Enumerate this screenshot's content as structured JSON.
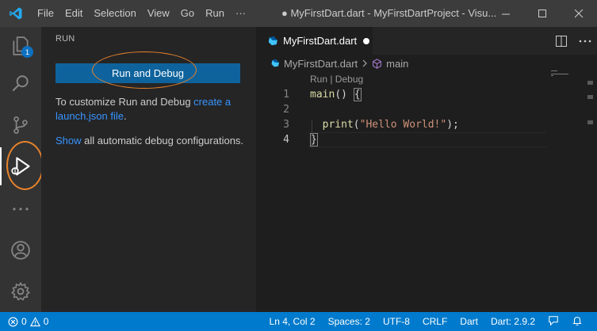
{
  "menu": [
    "File",
    "Edit",
    "Selection",
    "View",
    "Go",
    "Run",
    "···"
  ],
  "window_title": "● MyFirstDart.dart - MyFirstDartProject - Visu...",
  "activity_badge": "1",
  "sidebar": {
    "title": "RUN",
    "run_button": "Run and Debug",
    "customize_text": "To customize Run and Debug ",
    "customize_link": "create a launch.json file",
    "customize_end": ".",
    "show_link": "Show",
    "show_text": " all automatic debug configurations."
  },
  "editor": {
    "tab_label": "MyFirstDart.dart",
    "breadcrumb_file": "MyFirstDart.dart",
    "breadcrumb_symbol": "main",
    "codelens": "Run | Debug",
    "lines": [
      {
        "num": "1",
        "fn": "main",
        "rest": "() "
      },
      {
        "num": "2"
      },
      {
        "num": "3",
        "fn": "print",
        "str": "\"Hello World!\"",
        "end": ");"
      },
      {
        "num": "4"
      }
    ],
    "line1_brace": "{",
    "line3_indent": "  ",
    "line3_open": "(",
    "line4_brace": "}"
  },
  "status": {
    "errors": "0",
    "warnings": "0",
    "position": "Ln 4, Col 2",
    "spaces": "Spaces: 2",
    "encoding": "UTF-8",
    "eol": "CRLF",
    "language": "Dart",
    "sdk": "Dart: 2.9.2"
  },
  "colors": {
    "accent": "#007acc",
    "button": "#0e639c",
    "annotation": "#e8822a"
  }
}
